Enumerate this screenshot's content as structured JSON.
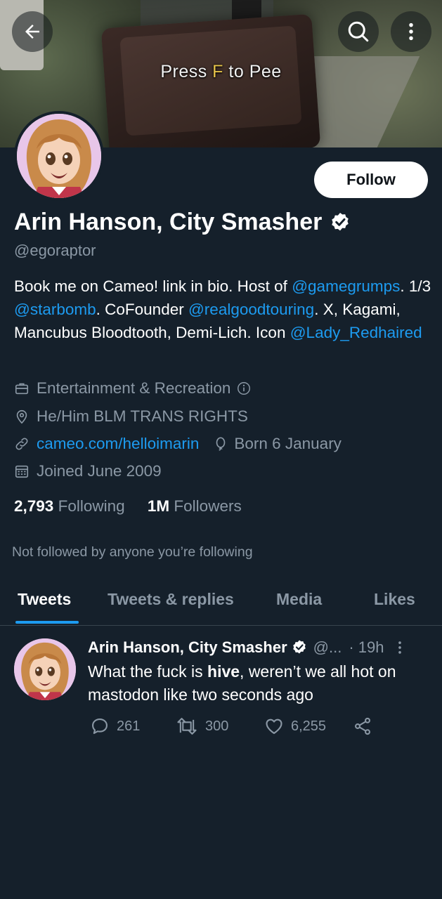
{
  "banner": {
    "caption_prefix": "Press ",
    "caption_key": "F",
    "caption_suffix": " to Pee"
  },
  "header": {
    "back_icon": "arrow-left-icon",
    "search_icon": "search-icon",
    "more_icon": "more-vertical-icon"
  },
  "profile": {
    "follow_label": "Follow",
    "display_name": "Arin Hanson, City Smasher",
    "handle": "@egoraptor",
    "bio": {
      "t1": "Book me on Cameo! link in bio. Host of ",
      "l1": "@gamegrumps",
      "t2": ". 1/3 ",
      "l2": "@starbomb",
      "t3": ". CoFounder ",
      "l3": "@realgoodtouring",
      "t4": ". X, Kagami, Mancubus Bloodtooth, Demi-Lich. Icon ",
      "l4": "@Lady_Redhaired"
    },
    "category": "Entertainment & Recreation",
    "location": "He/Him BLM TRANS RIGHTS",
    "website": "cameo.com/helloimarin",
    "birthday": "Born 6 January",
    "joined": "Joined June 2009",
    "following_count": "2,793",
    "following_label": "Following",
    "followers_count": "1M",
    "followers_label": "Followers",
    "not_followed": "Not followed by anyone you’re following"
  },
  "tabs": [
    {
      "label": "Tweets",
      "active": true
    },
    {
      "label": "Tweets & replies",
      "active": false
    },
    {
      "label": "Media",
      "active": false
    },
    {
      "label": "Likes",
      "active": false
    }
  ],
  "tweet": {
    "name": "Arin Hanson, City Smasher",
    "handle_truncated": "@...",
    "time": "· 19h",
    "text_pre": "What the fuck is ",
    "text_bold": "hive",
    "text_post": ", weren’t we all hot on mastodon like two seconds ago",
    "replies": "261",
    "retweets": "300",
    "likes": "6,255"
  },
  "colors": {
    "background": "#15202b",
    "accent": "#1d9bf0",
    "secondary_text": "#8b98a5"
  }
}
